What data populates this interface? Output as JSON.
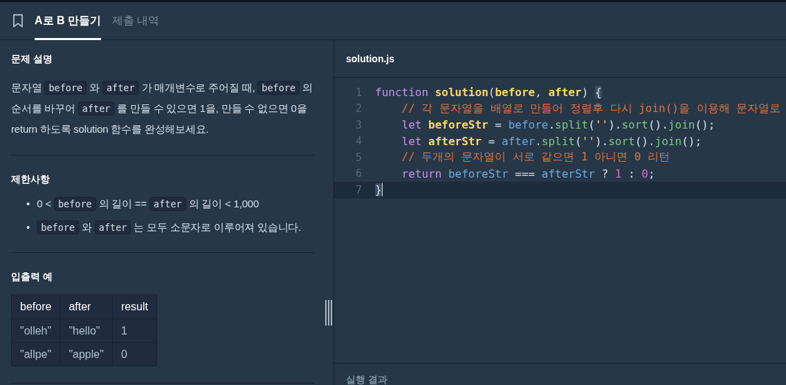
{
  "tabs": [
    {
      "label": "A로 B 만들기",
      "selected": true
    },
    {
      "label": "제출 내역",
      "selected": false
    }
  ],
  "description": {
    "title": "문제 설명",
    "paragraph": [
      {
        "kind": "text",
        "text": "문자열 "
      },
      {
        "kind": "code",
        "text": "before"
      },
      {
        "kind": "text",
        "text": " 와 "
      },
      {
        "kind": "code",
        "text": "after"
      },
      {
        "kind": "text",
        "text": " 가 매개변수로 주어질 때, "
      },
      {
        "kind": "code",
        "text": "before"
      },
      {
        "kind": "text",
        "text": " 의 순서를 바꾸어 "
      },
      {
        "kind": "code",
        "text": "after"
      },
      {
        "kind": "text",
        "text": " 를 만들 수 있으면 1을, 만들 수 없으면 0을 return 하도록 solution 함수를 완성해보세요."
      }
    ]
  },
  "constraints": {
    "title": "제한사항",
    "items": [
      {
        "bullet": "•",
        "segments": [
          {
            "kind": "text",
            "text": "0 < "
          },
          {
            "kind": "code",
            "text": "before"
          },
          {
            "kind": "text",
            "text": " 의 길이 == "
          },
          {
            "kind": "code",
            "text": "after"
          },
          {
            "kind": "text",
            "text": " 의 길이 < 1,000"
          }
        ]
      },
      {
        "bullet": "•",
        "segments": [
          {
            "kind": "code",
            "text": "before"
          },
          {
            "kind": "text",
            "text": " 와 "
          },
          {
            "kind": "code",
            "text": "after"
          },
          {
            "kind": "text",
            "text": " 는 모두 소문자로 이루어져 있습니다."
          }
        ]
      }
    ]
  },
  "examples": {
    "title": "입출력 예",
    "columns": [
      "before",
      "after",
      "result"
    ],
    "rows": [
      [
        "\"olleh\"",
        "\"hello\"",
        "1"
      ],
      [
        "\"allpe\"",
        "\"apple\"",
        "0"
      ]
    ]
  },
  "editor": {
    "filename": "solution.js",
    "lines": [
      {
        "number": "1",
        "indented": false,
        "current": false,
        "tokens": [
          {
            "kind": "keyword",
            "text": "function "
          },
          {
            "kind": "name",
            "text": "solution"
          },
          {
            "kind": "plain",
            "text": "("
          },
          {
            "kind": "name",
            "text": "before"
          },
          {
            "kind": "plain",
            "text": ", "
          },
          {
            "kind": "name",
            "text": "after"
          },
          {
            "kind": "plain",
            "text": ") "
          },
          {
            "kind": "match",
            "text": "{"
          }
        ]
      },
      {
        "number": "2",
        "indented": true,
        "current": false,
        "tokens": [
          {
            "kind": "comment",
            "text": "// 각 문자열을 배열로 만들어 정렬후 다시 join()을 이용해 문자열로"
          }
        ]
      },
      {
        "number": "3",
        "indented": true,
        "current": false,
        "tokens": [
          {
            "kind": "keyword",
            "text": "let "
          },
          {
            "kind": "name",
            "text": "beforeStr"
          },
          {
            "kind": "plain",
            "text": " = "
          },
          {
            "kind": "variable",
            "text": "before"
          },
          {
            "kind": "plain",
            "text": "."
          },
          {
            "kind": "method",
            "text": "split"
          },
          {
            "kind": "plain",
            "text": "("
          },
          {
            "kind": "string",
            "text": "''"
          },
          {
            "kind": "plain",
            "text": ")."
          },
          {
            "kind": "method",
            "text": "sort"
          },
          {
            "kind": "plain",
            "text": "()."
          },
          {
            "kind": "method",
            "text": "join"
          },
          {
            "kind": "plain",
            "text": "();"
          }
        ]
      },
      {
        "number": "4",
        "indented": true,
        "current": false,
        "tokens": [
          {
            "kind": "keyword",
            "text": "let "
          },
          {
            "kind": "name",
            "text": "afterStr"
          },
          {
            "kind": "plain",
            "text": " = "
          },
          {
            "kind": "variable",
            "text": "after"
          },
          {
            "kind": "plain",
            "text": "."
          },
          {
            "kind": "method",
            "text": "split"
          },
          {
            "kind": "plain",
            "text": "("
          },
          {
            "kind": "string",
            "text": "''"
          },
          {
            "kind": "plain",
            "text": ")."
          },
          {
            "kind": "method",
            "text": "sort"
          },
          {
            "kind": "plain",
            "text": "()."
          },
          {
            "kind": "method",
            "text": "join"
          },
          {
            "kind": "plain",
            "text": "();"
          }
        ]
      },
      {
        "number": "5",
        "indented": true,
        "current": false,
        "tokens": [
          {
            "kind": "comment",
            "text": "// 두개의 문자열이 서로 같으면 1 아니면 0 리턴"
          }
        ]
      },
      {
        "number": "6",
        "indented": true,
        "current": false,
        "tokens": [
          {
            "kind": "keyword",
            "text": "return "
          },
          {
            "kind": "variable",
            "text": "beforeStr"
          },
          {
            "kind": "plain",
            "text": " === "
          },
          {
            "kind": "variable",
            "text": "afterStr"
          },
          {
            "kind": "plain",
            "text": " ? "
          },
          {
            "kind": "number",
            "text": "1"
          },
          {
            "kind": "plain",
            "text": " : "
          },
          {
            "kind": "number",
            "text": "0"
          },
          {
            "kind": "plain",
            "text": ";"
          }
        ]
      },
      {
        "number": "7",
        "indented": false,
        "current": true,
        "tokens": [
          {
            "kind": "match",
            "text": "}"
          }
        ]
      }
    ]
  },
  "result": {
    "title": "실행 결과"
  }
}
